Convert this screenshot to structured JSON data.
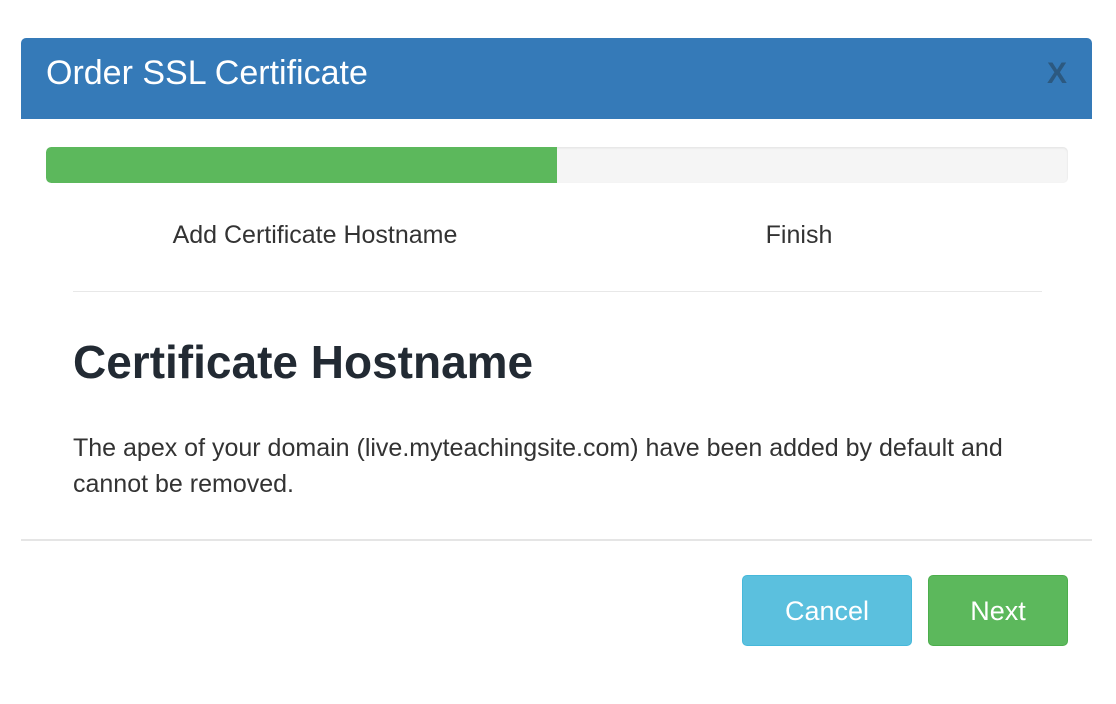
{
  "modal": {
    "title": "Order SSL Certificate",
    "close_label": "X"
  },
  "progress": {
    "percent": 50,
    "fill_color": "#5cb85c",
    "steps": [
      {
        "label": "Add Certificate Hostname"
      },
      {
        "label": "Finish"
      }
    ]
  },
  "content": {
    "heading": "Certificate Hostname",
    "description": "The apex of your domain (live.myteachingsite.com) have been added by default and cannot be removed."
  },
  "footer": {
    "cancel_label": "Cancel",
    "next_label": "Next"
  },
  "colors": {
    "header": "#357ab8",
    "cancel": "#5bc0de",
    "next": "#5cb85c"
  }
}
